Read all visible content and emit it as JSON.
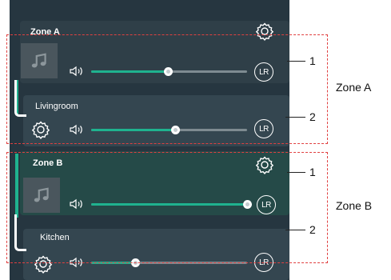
{
  "zones": [
    {
      "name": "Zone A",
      "zone_volume": 0.49,
      "room": {
        "name": "Livingroom",
        "volume": 0.54
      },
      "speaker_mode": "LR"
    },
    {
      "name": "Zone B",
      "zone_volume": 1.0,
      "room": {
        "name": "Kitchen",
        "volume": 0.28
      },
      "speaker_mode": "LR"
    }
  ],
  "annotations": {
    "zone_a_label": "Zone A",
    "zone_b_label": "Zone B",
    "marker_1": "1",
    "marker_2": "2"
  },
  "colors": {
    "accent": "#1fb28f",
    "annotation_border": "#e04040",
    "panel": "#263640"
  },
  "icons": [
    "gear-icon",
    "speaker-volume-icon",
    "music-note-icon",
    "lr-channel-icon"
  ]
}
